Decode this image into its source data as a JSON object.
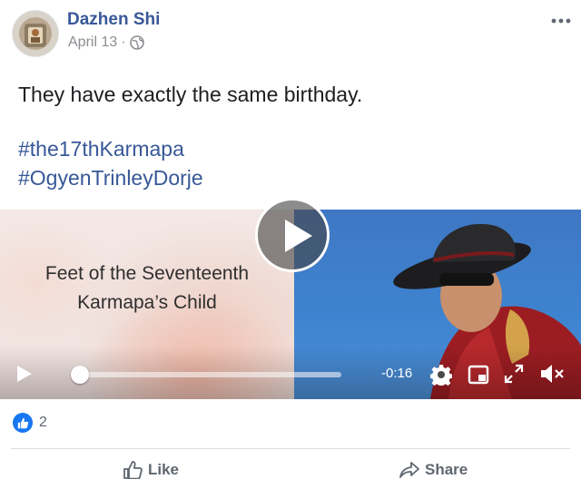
{
  "post": {
    "author": "Dazhen Shi",
    "date": "April 13",
    "separator": "·",
    "privacy_icon": "globe-icon",
    "text": "They have exactly the same birthday.",
    "hashtags": [
      "#the17thKarmapa",
      "#OgyenTrinleyDorje"
    ]
  },
  "video": {
    "caption_line1": "Feet of the Seventeenth",
    "caption_line2": "Karmapa’s Child",
    "time_remaining": "-0:16",
    "progress": 0.02,
    "icons": [
      "play-icon",
      "settings-gear-icon",
      "picture-in-picture-icon",
      "fullscreen-icon",
      "volume-muted-icon"
    ]
  },
  "reactions": {
    "icon": "like-reaction-icon",
    "count": "2"
  },
  "actions": {
    "like_label": "Like",
    "share_label": "Share"
  },
  "colors": {
    "author_link": "#385898",
    "like_blue": "#1877f2",
    "secondary_text": "#606770"
  }
}
